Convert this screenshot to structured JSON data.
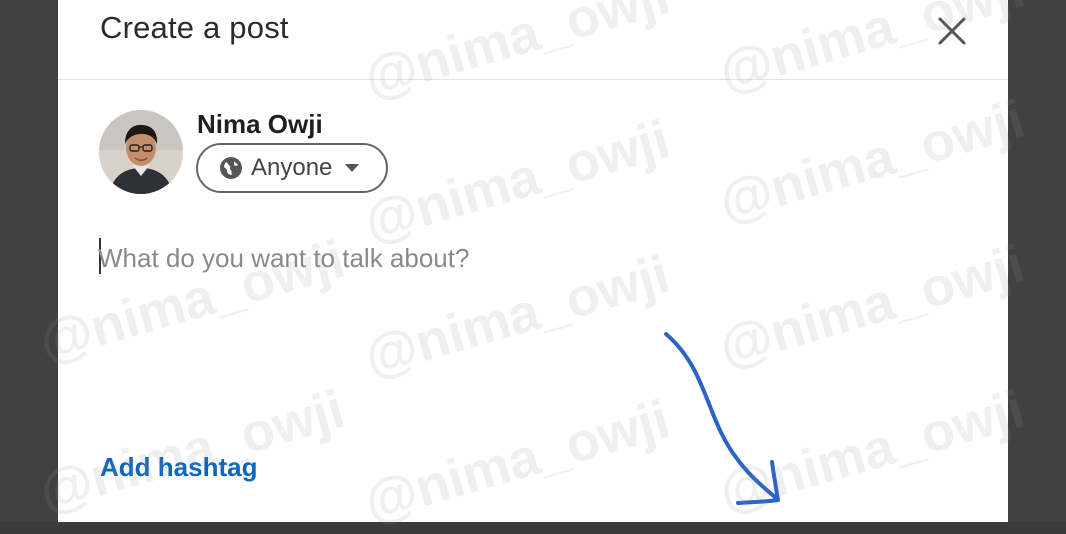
{
  "modal": {
    "title": "Create a post",
    "close_icon": "close-icon"
  },
  "author": {
    "name": "Nima Owji",
    "avatar_icon": "avatar-photo"
  },
  "visibility": {
    "label": "Anyone",
    "icon": "globe-icon",
    "caret_icon": "caret-down-icon"
  },
  "editor": {
    "placeholder": "What do you want to talk about?"
  },
  "footer": {
    "add_hashtag_label": "Add hashtag"
  },
  "watermark": {
    "text": "@nima_owji"
  },
  "colors": {
    "link": "#0a66c2",
    "backdrop": "#3b3b3b",
    "annotation_arrow": "#2b63c9"
  }
}
